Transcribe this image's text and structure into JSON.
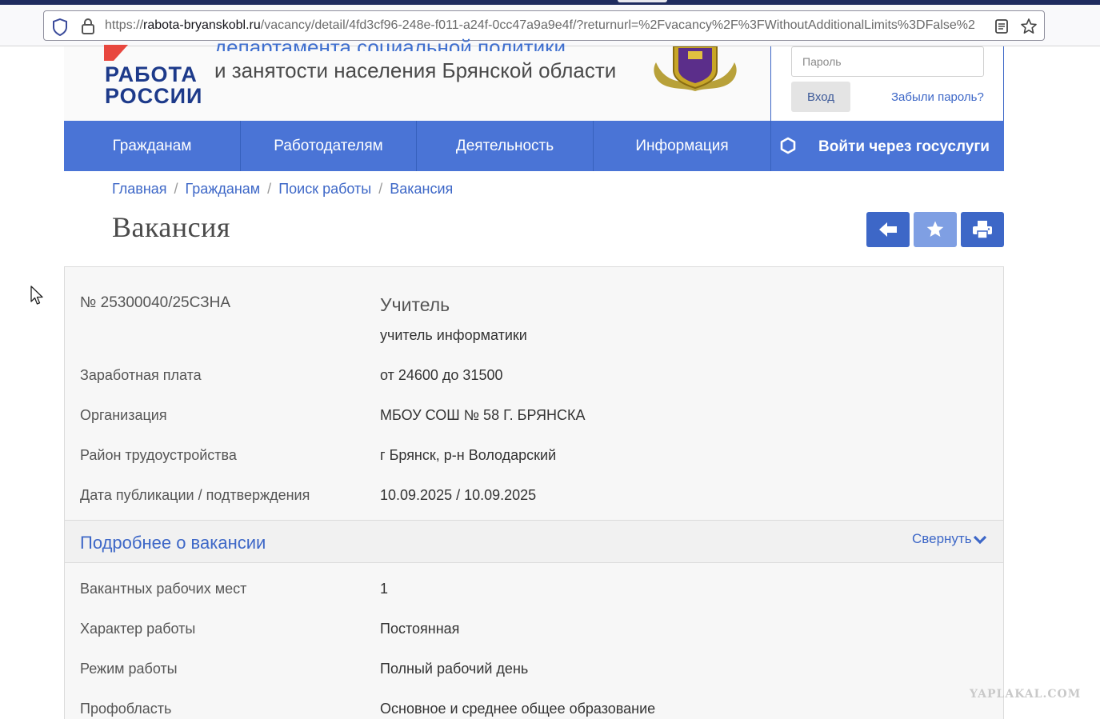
{
  "browser": {
    "url_host": "rabota-bryanskobl.ru",
    "url_path": "/vacancy/detail/4fd3cf96-248e-f011-a24f-0cc47a9a9e4f/?returnurl=%2Fvacancy%2F%3FWithoutAdditionalLimits%3DFalse%2",
    "url_scheme": "https://"
  },
  "header": {
    "logo_line1": "РАБОТА",
    "logo_line2": "РОССИИ",
    "dept_line1": "департамента социальной политики",
    "dept_line2": "и занятости населения Брянской области"
  },
  "login": {
    "password_placeholder": "Пароль",
    "login_label": "Вход",
    "forgot_label": "Забыли пароль?"
  },
  "nav": {
    "items": [
      {
        "label": "Гражданам"
      },
      {
        "label": "Работодателям"
      },
      {
        "label": "Деятельность"
      },
      {
        "label": "Информация"
      }
    ],
    "gosuslugi_label": "Войти через госуслуги"
  },
  "breadcrumb": [
    "Главная",
    "Гражданам",
    "Поиск работы",
    "Вакансия"
  ],
  "page_title": "Вакансия",
  "vacancy": {
    "number": "№ 25300040/25СЗНА",
    "title": "Учитель",
    "subtitle": "учитель информатики",
    "rows": [
      {
        "label": "Заработная плата",
        "value": "от 24600 до 31500"
      },
      {
        "label": "Организация",
        "value": "МБОУ СОШ № 58 Г. БРЯНСКА"
      },
      {
        "label": "Район трудоустройства",
        "value": "г Брянск, р-н Володарский"
      },
      {
        "label": "Дата публикации / подтверждения",
        "value": "10.09.2025 / 10.09.2025"
      }
    ]
  },
  "details": {
    "title": "Подробнее о вакансии",
    "collapse_label": "Свернуть",
    "rows": [
      {
        "label": "Вакантных рабочих мест",
        "value": "1"
      },
      {
        "label": "Характер работы",
        "value": "Постоянная"
      },
      {
        "label": "Режим работы",
        "value": "Полный рабочий день"
      },
      {
        "label": "Профобласть",
        "value": "Основное и среднее общее образование"
      }
    ]
  },
  "watermark": "YAPLAKAL.COM",
  "icons": {
    "shield": "shield-icon",
    "lock": "lock-icon",
    "reader": "reader-view-icon",
    "bookmark": "star-icon",
    "back": "arrow-left-icon",
    "favorite": "star-icon",
    "print": "print-icon",
    "gosuslugi": "gosuslugi-icon",
    "collapse": "chevron-down-icon",
    "cursor": "mouse-cursor-icon"
  },
  "colors": {
    "accent": "#3d67c7",
    "nav_bg": "#4a74d6",
    "fav_button": "#7f9fe3"
  }
}
